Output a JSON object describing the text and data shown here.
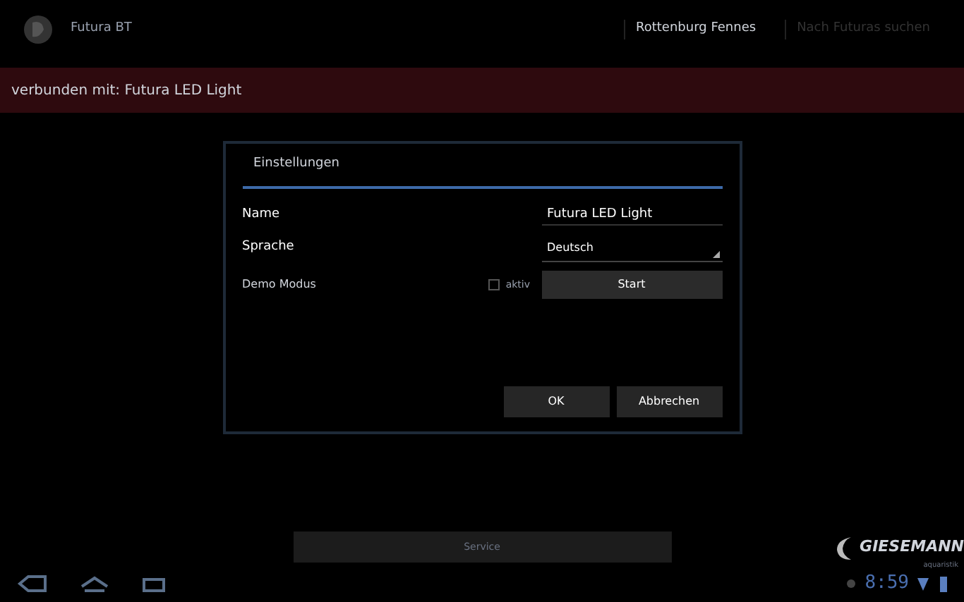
{
  "action_bar": {
    "title": "Futura BT",
    "actions": [
      {
        "label": "Rottenburg Fennes",
        "disabled": false
      },
      {
        "label": "Nach Futuras suchen",
        "disabled": true
      }
    ]
  },
  "banner": {
    "text": "verbunden mit: Futura LED Light"
  },
  "dialog": {
    "title": "Einstellungen",
    "name_label": "Name",
    "name_value": "Futura LED Light",
    "language_label": "Sprache",
    "language_value": "Deutsch",
    "demo_label": "Demo Modus",
    "demo_checkbox": {
      "label": "aktiv",
      "checked": false
    },
    "start_button": "Start",
    "buttons": [
      "OK",
      "Abbrechen"
    ]
  },
  "service_button": "Service",
  "logo": {
    "brand": "GIESEMANN",
    "tagline": "aquaristik"
  },
  "system_bar": {
    "time": "8:59"
  }
}
